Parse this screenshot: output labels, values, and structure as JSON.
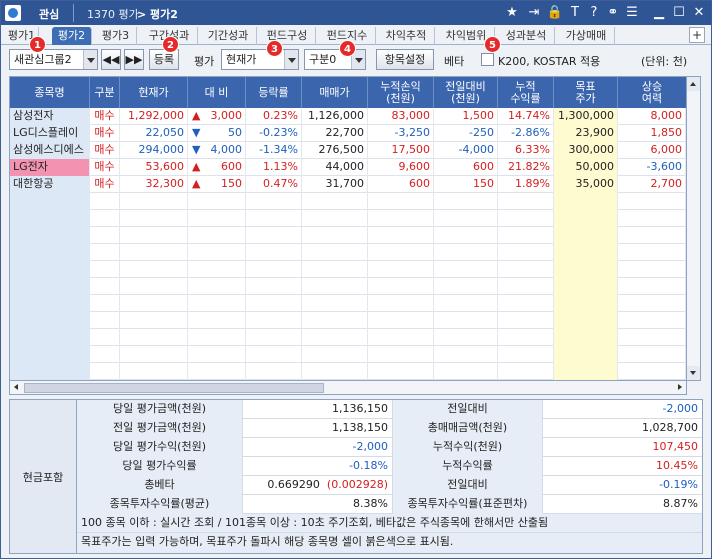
{
  "titlebar": {
    "tab": "관심",
    "screen_code": "1370 평가",
    "screen_title": "> 평가2"
  },
  "titlebar_icons": [
    "star-icon",
    "export-icon",
    "lock-icon",
    "text-icon",
    "help-icon",
    "link-icon",
    "list-icon",
    "minimize-icon",
    "maximize-icon",
    "close-icon"
  ],
  "tabs": [
    "평가1",
    "평가2",
    "평가3",
    "구간성과",
    "기간성과",
    "펀드구성",
    "펀드지수",
    "차익추적",
    "차익범위",
    "성과분석",
    "가상매매"
  ],
  "tab_plus": "+",
  "toolbar": {
    "group_select": "새관심그룹2",
    "register_button": "등록",
    "eval_label": "평가",
    "price_select": "현재가",
    "category_select": "구분0",
    "item_settings_button": "항목설정",
    "beta_label": "베타",
    "kospi_label": "K200, KOSTAR 적용",
    "unit_label": "(단위: 천)",
    "badges": [
      "1",
      "2",
      "3",
      "4",
      "5"
    ]
  },
  "columns": [
    "종목명",
    "구분",
    "현재가",
    "대  비",
    "등락률",
    "매매가",
    "누적손익\n(천원)",
    "전일대비\n(천원)",
    "누적\n수익률",
    "목표\n주가",
    "상승\n여력"
  ],
  "rows": [
    {
      "name": "삼성전자",
      "gubun": "매수",
      "price": "1,292,000",
      "dir": "up",
      "diff": "3,000",
      "rate": "0.23%",
      "trade": "1,126,000",
      "cum": "83,000",
      "prev": "1,500",
      "cumrate": "14.74%",
      "target": "1,300,000",
      "upside": "8,000"
    },
    {
      "name": "LG디스플레이",
      "gubun": "매수",
      "price": "22,050",
      "dir": "down",
      "diff": "50",
      "rate": "-0.23%",
      "trade": "22,700",
      "cum": "-3,250",
      "prev": "-250",
      "cumrate": "-2.86%",
      "target": "23,900",
      "upside": "1,850"
    },
    {
      "name": "삼성에스디에스",
      "gubun": "매수",
      "price": "294,000",
      "dir": "down",
      "diff": "4,000",
      "rate": "-1.34%",
      "trade": "276,500",
      "cum": "17,500",
      "prev": "-4,000",
      "cumrate": "6.33%",
      "target": "300,000",
      "upside": "6,000"
    },
    {
      "name": "LG전자",
      "gubun": "매수",
      "price": "53,600",
      "dir": "up",
      "diff": "600",
      "rate": "1.13%",
      "trade": "44,000",
      "cum": "9,600",
      "prev": "600",
      "cumrate": "21.82%",
      "target": "50,000",
      "upside": "-3,600"
    },
    {
      "name": "대한항공",
      "gubun": "매수",
      "price": "32,300",
      "dir": "up",
      "diff": "150",
      "rate": "0.47%",
      "trade": "31,700",
      "cum": "600",
      "prev": "150",
      "cumrate": "1.89%",
      "target": "35,000",
      "upside": "2,700"
    }
  ],
  "summary": {
    "side_label": "현금포함",
    "r1": {
      "l1": "당일 평가금액(천원)",
      "v1": "1,136,150",
      "l2": "전일대비",
      "v2": "-2,000"
    },
    "r2": {
      "l1": "전일 평가금액(천원)",
      "v1": "1,138,150",
      "l2": "총매매금액(천원)",
      "v2": "1,028,700"
    },
    "r3": {
      "l1": "당일 평가수익(천원)",
      "v1": "-2,000",
      "l2": "누적수익(천원)",
      "v2": "107,450"
    },
    "r4": {
      "l1": "당일 평가수익률",
      "v1": "-0.18%",
      "l2": "누적수익률",
      "v2": "10.45%"
    },
    "r5": {
      "l1": "총베타",
      "v1a": "0.669290",
      "v1b": "(0.002928)",
      "l2": "전일대비",
      "v2": "-0.19%"
    },
    "r6": {
      "l1": "종목투자수익률(평균)",
      "v1": "8.38%",
      "l2": "종목투자수익률(표준편차)",
      "v2": "8.87%"
    },
    "note1": "100 종목 이하 : 실시간 조회 / 101종목 이상 : 10초 주기조회, 베타값은 주식종목에 한해서만 산출됨",
    "note2": "목표주가는 입력 가능하며, 목표주가 돌파시 해당 종목명 셀이 붉은색으로 표시됨."
  }
}
